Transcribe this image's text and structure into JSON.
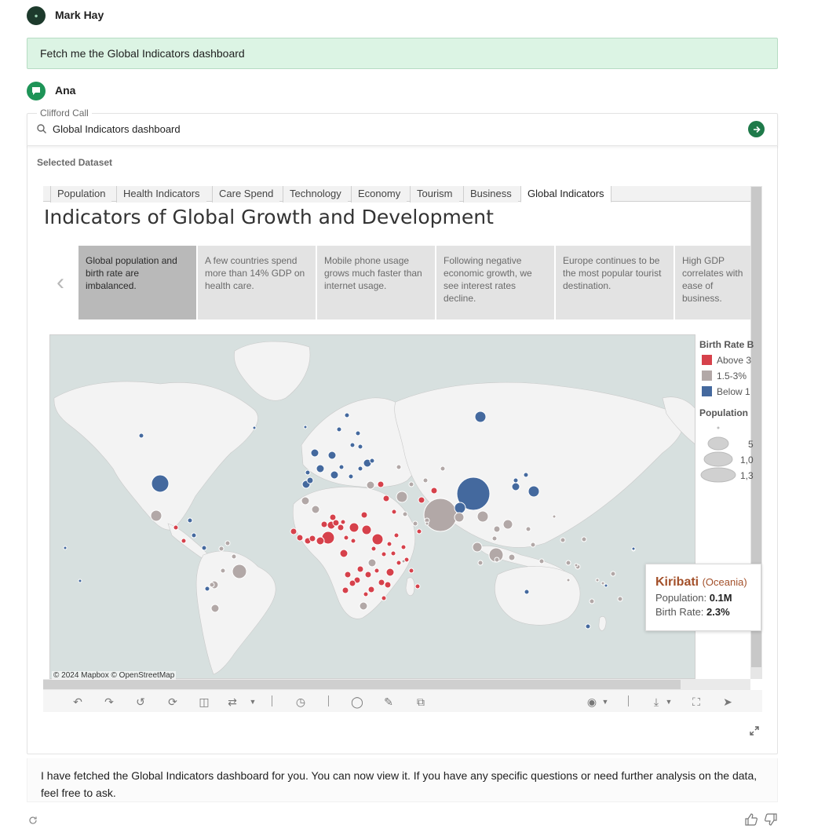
{
  "user": {
    "name": "Mark Hay",
    "avatar_text": "●",
    "message": "Fetch me the Global Indicators dashboard"
  },
  "assistant": {
    "name": "Ana"
  },
  "tool_call": {
    "label": "Clifford Call",
    "query": "Global Indicators dashboard"
  },
  "dataset": {
    "label": "Selected Dataset"
  },
  "dashboard": {
    "tabs": [
      "Population",
      "Health Indicators",
      "Care Spend",
      "Technology",
      "Economy",
      "Tourism",
      "Business",
      "Global Indicators"
    ],
    "active_tab": "Global Indicators",
    "title": "Indicators of Global Growth and Development",
    "story_points": [
      "Global population and birth rate are imbalanced.",
      "A few countries spend more than 14% GDP on health care.",
      "Mobile phone usage grows much faster than internet usage.",
      "Following negative economic growth, we see interest rates decline.",
      "Europe continues to be the most popular tourist destination.",
      "High GDP correlates with ease of business."
    ],
    "active_story": 0,
    "legend": {
      "birth_rate_title": "Birth Rate B",
      "items": [
        {
          "label": "Above 3",
          "color": "#d6414b"
        },
        {
          "label": "1.5-3%",
          "color": "#b2a8a7"
        },
        {
          "label": "Below 1",
          "color": "#44699e"
        }
      ],
      "population_title": "Population",
      "size_labels": [
        "5",
        "1,0",
        "1,3"
      ]
    },
    "tooltip": {
      "country": "Kiribati",
      "region": "(Oceania)",
      "population_label": "Population:",
      "population_value": "0.1M",
      "birth_rate_label": "Birth Rate:",
      "birth_rate_value": "2.3%"
    },
    "attribution": "© 2024 Mapbox  © OpenStreetMap"
  },
  "reply": "I have fetched the Global Indicators dashboard for you. You can now view it. If you have any specific questions or need further analysis on the data, feel free to ask.",
  "colors": {
    "accent": "#1f7a4a",
    "user_bubble": "#dcf4e4",
    "red": "#d6414b",
    "grey": "#b2a8a7",
    "blue": "#44699e",
    "ocean": "#d7e0df",
    "land": "#f3f3f3"
  }
}
